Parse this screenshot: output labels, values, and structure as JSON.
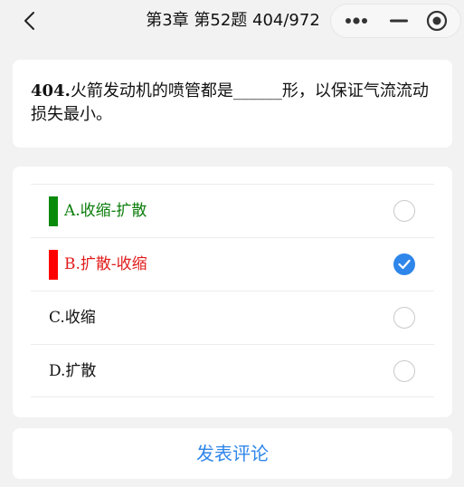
{
  "nav": {
    "title": "第3章 第52题 404/972",
    "icons": [
      "chevron-left-icon",
      "more-icon",
      "minimize-icon",
      "close-circle-icon"
    ]
  },
  "question": {
    "number": "404.",
    "text": "火箭发动机的喷管都是______形，以保证气流流动损失最小。"
  },
  "options": [
    {
      "label": "A.收缩-扩散",
      "state": "correct",
      "color": "#0a7d0a",
      "bar_color": "#0a8a0a",
      "checked": false
    },
    {
      "label": "B.扩散-收缩",
      "state": "selected-wrong",
      "color": "#e11b1b",
      "bar_color": "#ff0000",
      "checked": true
    },
    {
      "label": "C.收缩",
      "state": "normal",
      "color": "#111111",
      "checked": false
    },
    {
      "label": "D.扩散",
      "state": "normal",
      "color": "#111111",
      "checked": false
    }
  ],
  "comment": {
    "label": "发表评论",
    "color": "#2f86ea"
  }
}
